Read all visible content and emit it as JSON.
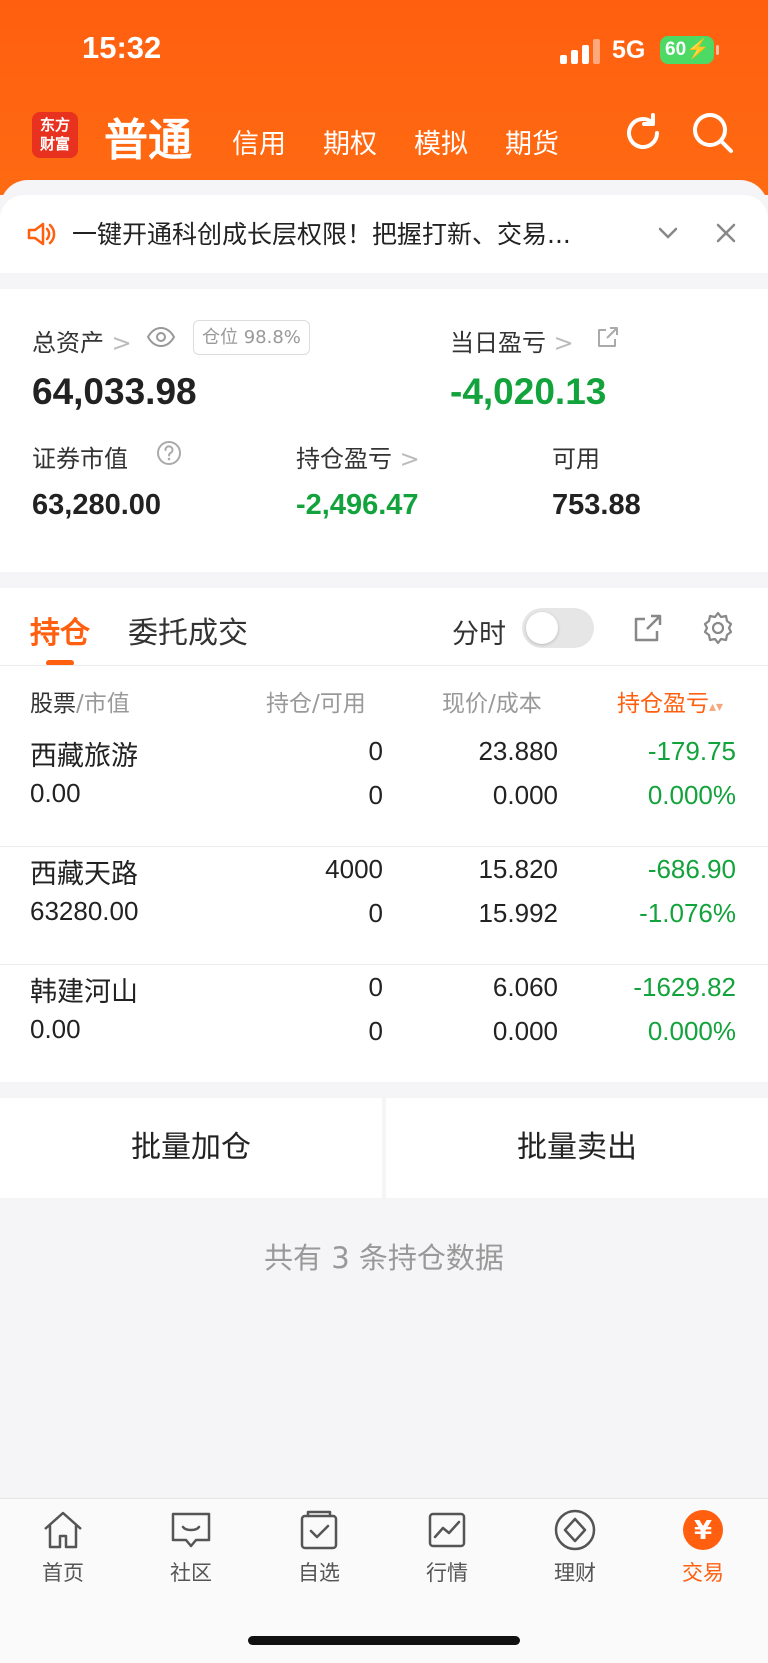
{
  "status_bar": {
    "time": "15:32",
    "network": "5G",
    "battery": "60"
  },
  "header": {
    "logo": [
      "东方",
      "财富"
    ],
    "active_tab": "普通",
    "tabs": [
      "信用",
      "期权",
      "模拟",
      "期货"
    ]
  },
  "banner": {
    "text": "一键开通科创成长层权限！把握打新、交易..."
  },
  "assets": {
    "total_label": "总资产",
    "position_ratio": "仓位 98.8%",
    "total_value": "64,033.98",
    "daily_label": "当日盈亏",
    "daily_value": "-4,020.13",
    "market_label": "证券市值",
    "market_value": "63,280.00",
    "holding_pl_label": "持仓盈亏",
    "holding_pl_value": "-2,496.47",
    "available_label": "可用",
    "available_value": "753.88"
  },
  "positions": {
    "tabs": [
      "持仓",
      "委托成交"
    ],
    "timeshare_label": "分时",
    "headers": {
      "stock": "股票",
      "market": "/市值",
      "hold": "持仓",
      "avail": "/可用",
      "price": "现价",
      "cost": "/成本",
      "pl": "持仓盈亏"
    },
    "rows": [
      {
        "name": "西藏旅游",
        "value": "0.00",
        "hold": "0",
        "avail": "0",
        "price": "23.880",
        "cost": "0.000",
        "pl": "-179.75",
        "pl_pct": "0.000%"
      },
      {
        "name": "西藏天路",
        "value": "63280.00",
        "hold": "4000",
        "avail": "0",
        "price": "15.820",
        "cost": "15.992",
        "pl": "-686.90",
        "pl_pct": "-1.076%"
      },
      {
        "name": "韩建河山",
        "value": "0.00",
        "hold": "0",
        "avail": "0",
        "price": "6.060",
        "cost": "0.000",
        "pl": "-1629.82",
        "pl_pct": "0.000%"
      }
    ]
  },
  "actions": {
    "batch_add": "批量加仓",
    "batch_sell": "批量卖出"
  },
  "summary": "共有 3 条持仓数据",
  "tabbar": {
    "items": [
      "首页",
      "社区",
      "自选",
      "行情",
      "理财",
      "交易"
    ],
    "trade_glyph": "¥"
  },
  "colors": {
    "accent": "#ff5f0f",
    "loss": "#13a33c"
  }
}
